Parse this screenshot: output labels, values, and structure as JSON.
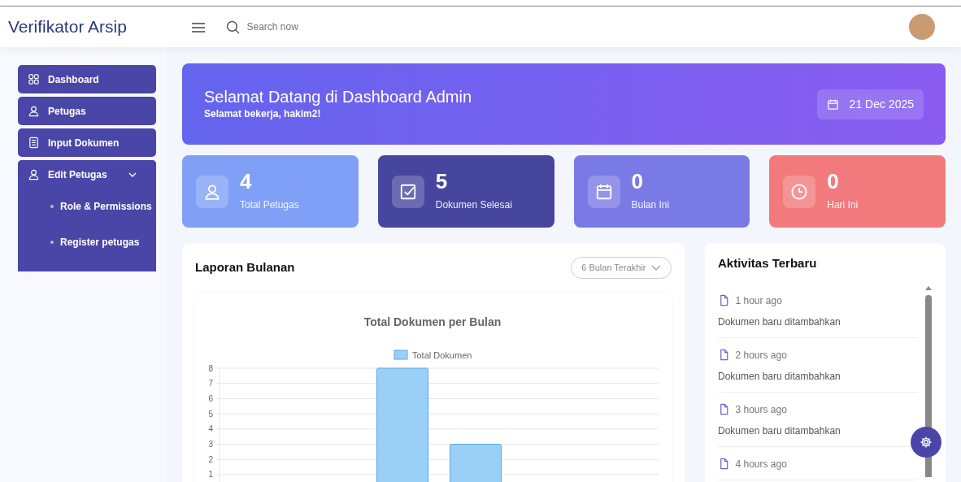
{
  "header": {
    "brand": "Verifikator Arsip",
    "search": {
      "placeholder": "Search now"
    }
  },
  "sidebar": {
    "items": [
      {
        "kind": "link",
        "label": "Dashboard"
      },
      {
        "kind": "link",
        "label": "Petugas"
      },
      {
        "kind": "link",
        "label": "Input Dokumen"
      },
      {
        "kind": "group",
        "label": "Edit Petugas",
        "expanded": true,
        "children": [
          {
            "label": "Role & Permissions"
          },
          {
            "label": "Register petugas"
          }
        ]
      }
    ]
  },
  "banner": {
    "title": "Selamat Datang di Dashboard Admin",
    "subtitle": "Selamat bekerja, hakim2!",
    "date": "21 Dec 2025"
  },
  "stats": [
    {
      "value": "4",
      "label": "Total Petugas",
      "color": "#7fa0f6"
    },
    {
      "value": "5",
      "label": "Dokumen Selesai",
      "color": "#46469e"
    },
    {
      "value": "0",
      "label": "Bulan Ini",
      "color": "#7a7ae6"
    },
    {
      "value": "0",
      "label": "Hari Ini",
      "color": "#f37a7c"
    }
  ],
  "report": {
    "title": "Laporan Bulanan",
    "period": "6 Bulan Terakhir",
    "chart_data": {
      "type": "bar",
      "title": "Total Dokumen per Bulan",
      "ylim": [
        0,
        8
      ],
      "grid": true,
      "yticks": [
        1,
        2,
        3,
        4,
        5,
        6,
        7,
        8
      ],
      "series": [
        {
          "name": "Total Dokumen",
          "color": "#9ad0f5",
          "values": [
            0,
            0,
            8,
            3,
            0,
            0
          ]
        }
      ]
    }
  },
  "activity": {
    "title": "Aktivitas Terbaru",
    "items": [
      {
        "time": "1 hour ago",
        "text": "Dokumen baru ditambahkan"
      },
      {
        "time": "2 hours ago",
        "text": "Dokumen baru ditambahkan"
      },
      {
        "time": "3 hours ago",
        "text": "Dokumen baru ditambahkan"
      },
      {
        "time": "4 hours ago"
      }
    ]
  }
}
